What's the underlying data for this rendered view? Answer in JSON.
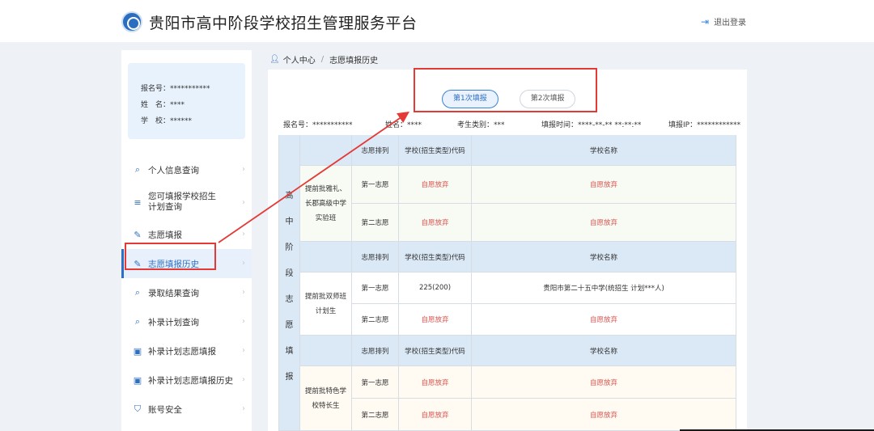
{
  "site": {
    "title": "贵阳市高中阶段学校招生管理服务平台",
    "logout": "退出登录"
  },
  "profile": {
    "line1": "报名号：***********",
    "line2": "姓　名：****",
    "line3": "学　校：******"
  },
  "menu": [
    {
      "label": "个人信息查询",
      "icon": "search-user-icon"
    },
    {
      "label": "您可填报学校招生计划查询",
      "icon": "list-search-icon"
    },
    {
      "label": "志愿填报",
      "icon": "edit-icon"
    },
    {
      "label": "志愿填报历史",
      "icon": "edit-history-icon"
    },
    {
      "label": "录取结果查询",
      "icon": "search-icon"
    },
    {
      "label": "补录计划查询",
      "icon": "search-icon"
    },
    {
      "label": "补录计划志愿填报",
      "icon": "form-icon"
    },
    {
      "label": "补录计划志愿填报历史",
      "icon": "form-history-icon"
    },
    {
      "label": "账号安全",
      "icon": "shield-icon"
    }
  ],
  "breadcrumb": {
    "home": "个人中心",
    "sep": "/",
    "current": "志愿填报历史"
  },
  "tabs": [
    "第1次填报",
    "第2次填报"
  ],
  "info": {
    "regno": "报名号：***********",
    "name": "姓名：****",
    "category": "考生类别：***",
    "time": "填报时间：****-**-** **:**:**",
    "ip": "填报IP：************"
  },
  "table": {
    "side_label": [
      "高",
      "中",
      "阶",
      "段",
      "志",
      "愿",
      "填",
      "报"
    ],
    "headers": {
      "order": "志愿排列",
      "code": "学校(招生类型)代码",
      "school": "学校名称"
    },
    "groups": [
      {
        "name": "提前批雅礼、长郡高级中学实验班",
        "rows": [
          {
            "order": "第一志愿",
            "code": "自愿放弃",
            "school": "自愿放弃"
          },
          {
            "order": "第二志愿",
            "code": "自愿放弃",
            "school": "自愿放弃"
          }
        ]
      },
      {
        "name": "提前批双师班计划生",
        "rows": [
          {
            "order": "第一志愿",
            "code": "225(200)",
            "school": "贵阳市第二十五中学(统招生 计划***人)"
          },
          {
            "order": "第二志愿",
            "code": "自愿放弃",
            "school": "自愿放弃"
          }
        ]
      },
      {
        "name": "提前批特色学校特长生",
        "rows": [
          {
            "order": "第一志愿",
            "code": "自愿放弃",
            "school": "自愿放弃"
          },
          {
            "order": "第二志愿",
            "code": "自愿放弃",
            "school": "自愿放弃"
          }
        ]
      }
    ]
  },
  "colors": {
    "accent": "#2d6fc4",
    "highlight": "#e53935",
    "header_bg": "#dbe9f7"
  }
}
